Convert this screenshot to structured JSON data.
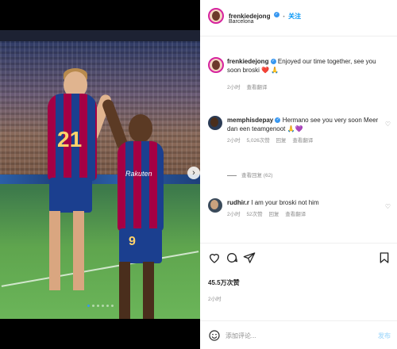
{
  "post": {
    "carousel": {
      "dot_count": 6,
      "active_index": 0,
      "next_icon": "chevron-right-icon"
    },
    "photo": {
      "sponsor_text": "Rakuten",
      "player1_number": "21",
      "player2_number": "9"
    }
  },
  "header": {
    "username": "frenkiedejong",
    "follow_label": "关注",
    "separator": "•",
    "location": "Barcelona"
  },
  "caption": {
    "username": "frenkiedejong",
    "text": "Enjoyed our time together, see you soon broski ❤️ 🙏",
    "time": "2小时"
  },
  "comments": [
    {
      "username": "memphisdepay",
      "text": "Hermano see you very soon Meer dan een teamgenoot 🙏💜",
      "time": "2小时",
      "likes": "5,026次赞",
      "reply_label": "回复",
      "translate_label": "查看翻译",
      "view_replies": "查看回复 (62)"
    },
    {
      "username": "rudhir.r",
      "text": "I am your broski not him",
      "time": "2小时",
      "likes": "52次赞",
      "reply_label": "回复",
      "translate_label": "查看翻译"
    }
  ],
  "caption_translate": "查看翻译",
  "actions": {
    "likes": "45.5万次赞",
    "time": "2小时"
  },
  "composer": {
    "placeholder": "添加评论...",
    "post_label": "发布"
  },
  "colors": {
    "accent": "#0095f6",
    "verified": "#3897f0",
    "muted": "#8e8e8e",
    "barca_red": "#a50044",
    "barca_blue": "#1b3f8f"
  }
}
